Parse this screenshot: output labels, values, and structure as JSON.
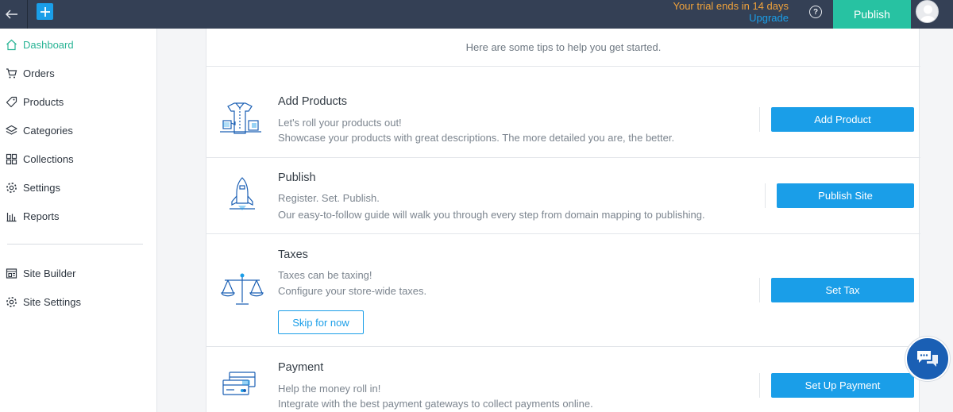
{
  "topbar": {
    "trial_text": "Your trial ends in 14 days",
    "upgrade_label": "Upgrade",
    "publish_label": "Publish",
    "help_glyph": "?",
    "icons": {
      "back": "arrow-left-icon",
      "add": "plus-icon",
      "help": "question-circle-icon",
      "avatar": "user-avatar-icon"
    },
    "colors": {
      "bar": "#344055",
      "trial": "#f0a23b",
      "upgrade": "#1a9ee8",
      "publish": "#27c2a2"
    }
  },
  "sidebar": {
    "items": [
      {
        "label": "Dashboard",
        "icon": "home-icon",
        "active": true
      },
      {
        "label": "Orders",
        "icon": "cart-icon"
      },
      {
        "label": "Products",
        "icon": "tag-icon"
      },
      {
        "label": "Categories",
        "icon": "layers-icon"
      },
      {
        "label": "Collections",
        "icon": "grid-icon"
      },
      {
        "label": "Settings",
        "icon": "gear-icon"
      },
      {
        "label": "Reports",
        "icon": "bar-chart-icon"
      }
    ],
    "secondary": [
      {
        "label": "Site Builder",
        "icon": "site-builder-icon"
      },
      {
        "label": "Site Settings",
        "icon": "gear-icon"
      }
    ],
    "colors": {
      "active": "#27b394"
    }
  },
  "main": {
    "tips": "Here are some tips to help you get started.",
    "rows": [
      {
        "title": "Add Products",
        "desc1": "Let's roll your products out!",
        "desc2": "Showcase your products with great descriptions. The more detailed you are, the better.",
        "button": "Add Product",
        "icon": "product-boxes-icon"
      },
      {
        "title": "Publish",
        "desc1": "Register. Set. Publish.",
        "desc2": "Our easy-to-follow guide will walk you through every step from domain mapping to publishing.",
        "button": "Publish Site",
        "icon": "rocket-icon"
      },
      {
        "title": "Taxes",
        "desc1": "Taxes can be taxing!",
        "desc2": "Configure your store-wide taxes.",
        "button": "Set Tax",
        "secondary_button": "Skip for now",
        "icon": "scales-icon"
      },
      {
        "title": "Payment",
        "desc1": "Help the money roll in!",
        "desc2": "Integrate with the best payment gateways to collect payments online.",
        "button": "Set Up Payment",
        "icon": "payment-cards-icon"
      }
    ],
    "colors": {
      "button": "#1a9ee8"
    }
  },
  "chat": {
    "icon": "chat-bubbles-icon"
  }
}
